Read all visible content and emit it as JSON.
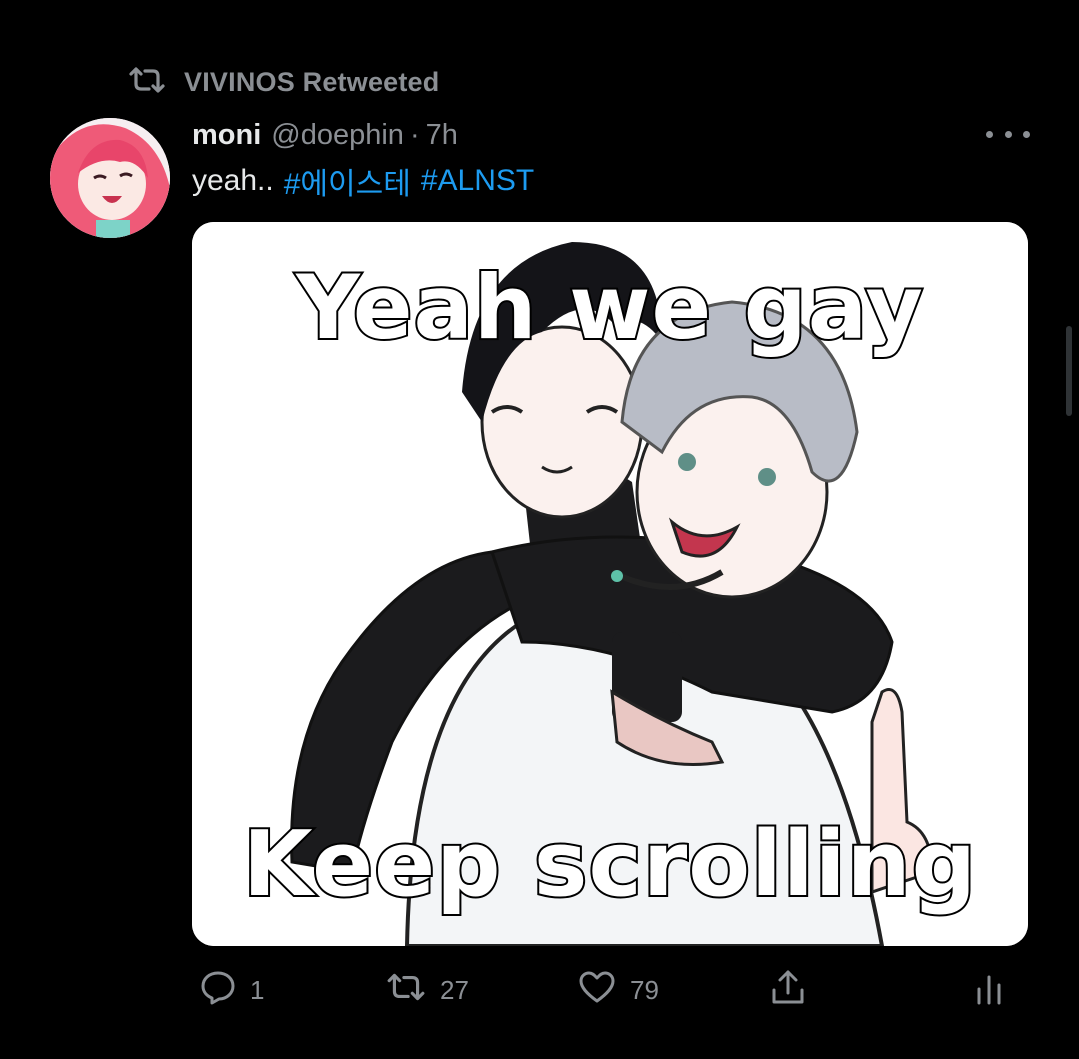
{
  "retweet": {
    "icon": "retweet-icon",
    "label": "VIVINOS Retweeted"
  },
  "tweet": {
    "author_name": "moni",
    "handle": "@doephin",
    "separator": "·",
    "time": "7h",
    "text_prefix": "yeah..",
    "hashtags": [
      "#에이스테",
      "#ALNST"
    ],
    "media": {
      "top_caption": "Yeah we gay",
      "bottom_caption": "Keep scrolling"
    }
  },
  "actions": {
    "reply_count": "1",
    "retweet_count": "27",
    "like_count": "79"
  },
  "colors": {
    "background": "#000000",
    "muted": "#8b8f94",
    "link": "#1d9bf0"
  }
}
